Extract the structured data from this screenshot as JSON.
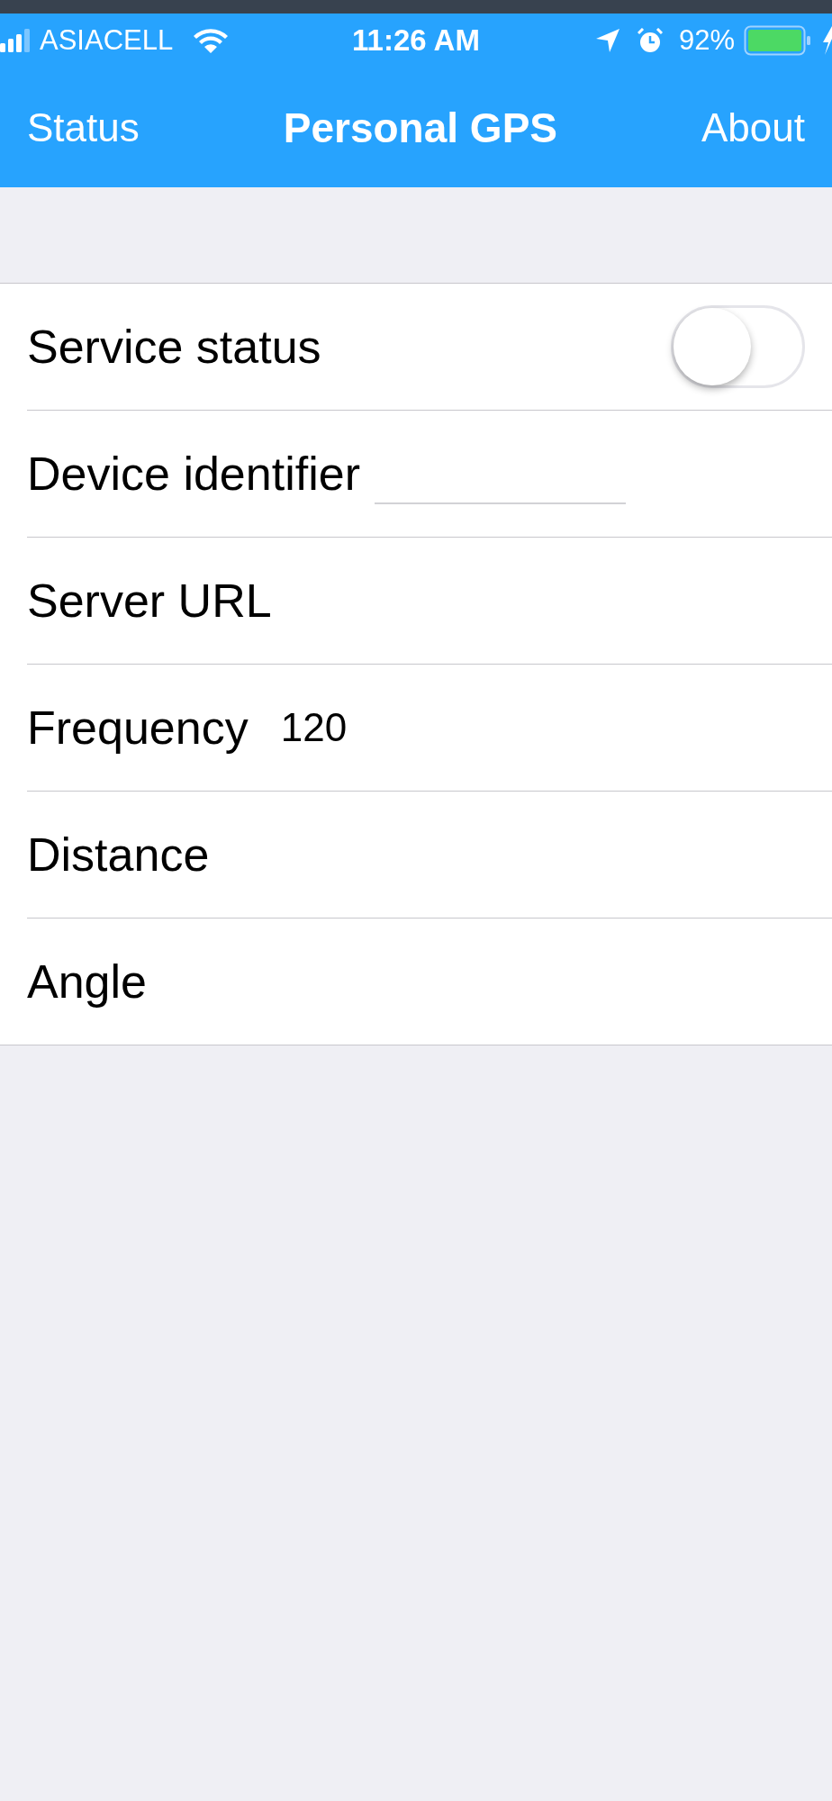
{
  "status_bar": {
    "carrier": "ASIACELL",
    "time": "11:26 AM",
    "battery": "92%"
  },
  "nav_bar": {
    "left": "Status",
    "title": "Personal GPS",
    "right": "About"
  },
  "rows": [
    {
      "kind": "switch",
      "label": "Service status",
      "on": false
    },
    {
      "kind": "input",
      "label": "Device identifier"
    },
    {
      "kind": "label",
      "label": "Server URL"
    },
    {
      "kind": "value",
      "label": "Frequency",
      "value": "120"
    },
    {
      "kind": "label",
      "label": "Distance"
    },
    {
      "kind": "label",
      "label": "Angle"
    }
  ]
}
